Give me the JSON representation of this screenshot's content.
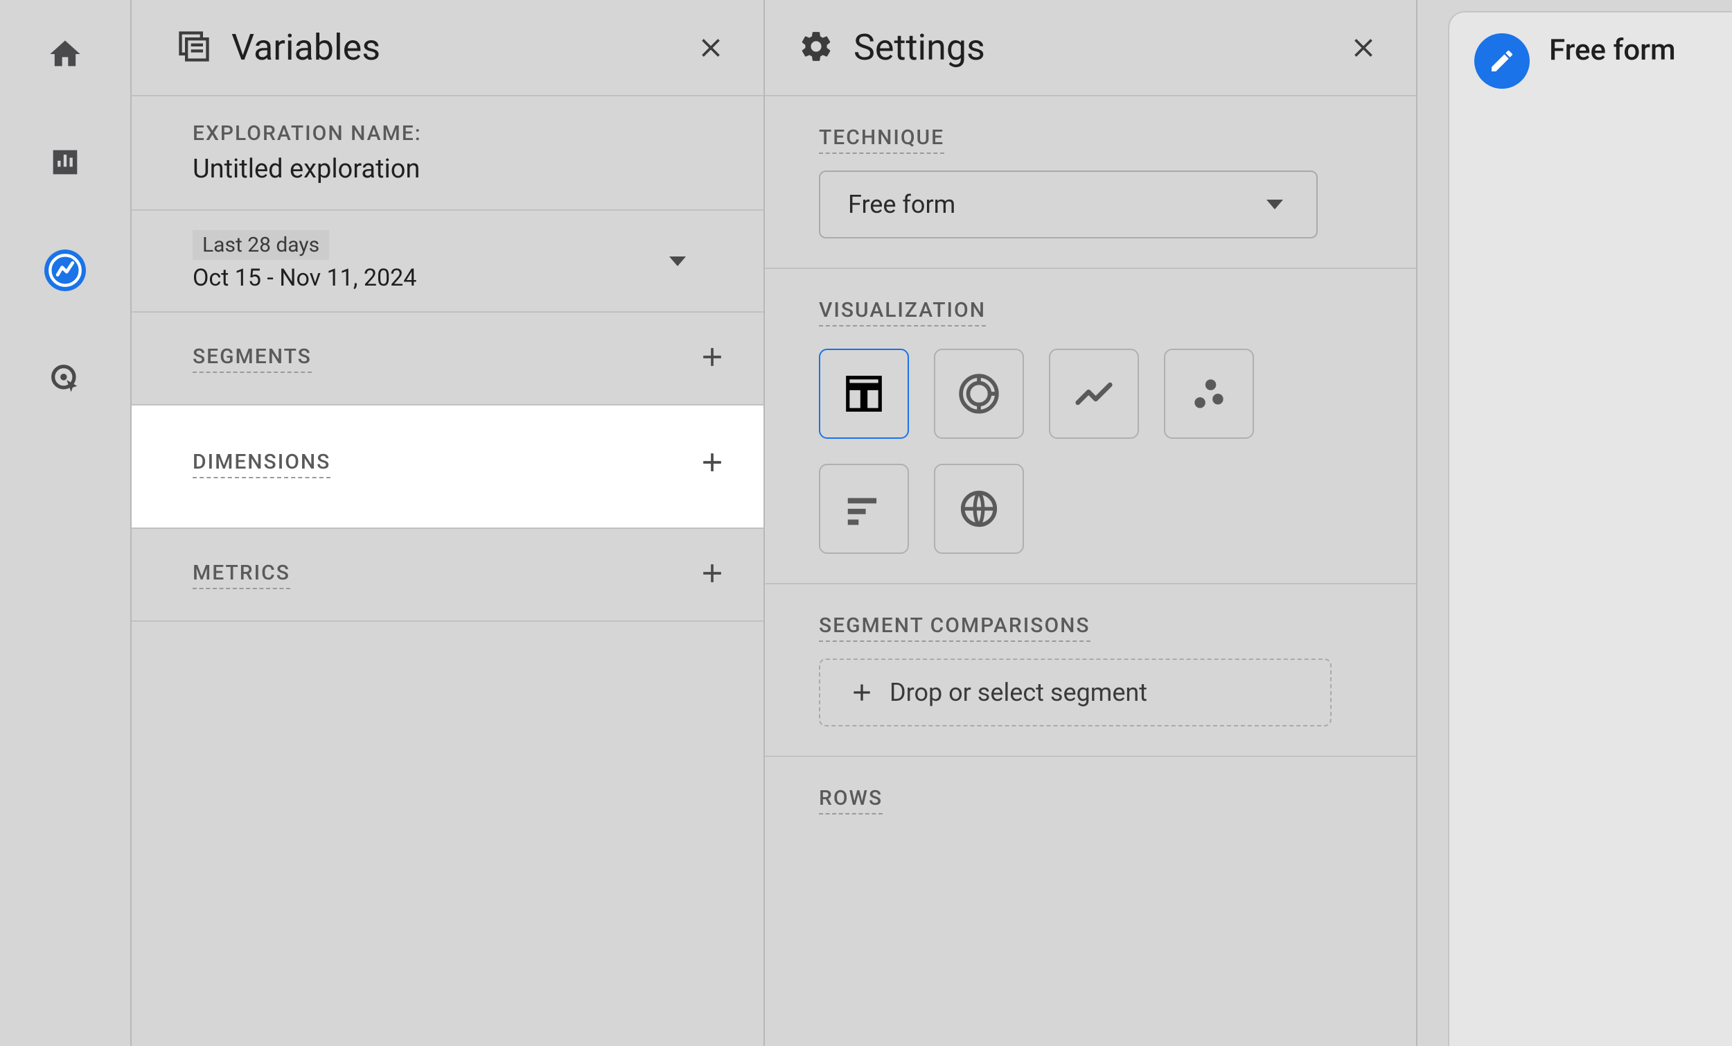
{
  "variables": {
    "panel_title": "Variables",
    "exploration_name_label": "EXPLORATION NAME:",
    "exploration_name_value": "Untitled exploration",
    "date_chip": "Last 28 days",
    "date_range": "Oct 15 - Nov 11, 2024",
    "segments_label": "SEGMENTS",
    "dimensions_label": "DIMENSIONS",
    "metrics_label": "METRICS"
  },
  "settings": {
    "panel_title": "Settings",
    "technique_label": "TECHNIQUE",
    "technique_value": "Free form",
    "visualization_label": "VISUALIZATION",
    "segment_comparisons_label": "SEGMENT COMPARISONS",
    "segment_drop_text": "Drop or select segment",
    "rows_label": "ROWS"
  },
  "canvas": {
    "tab_title": "Free form"
  }
}
